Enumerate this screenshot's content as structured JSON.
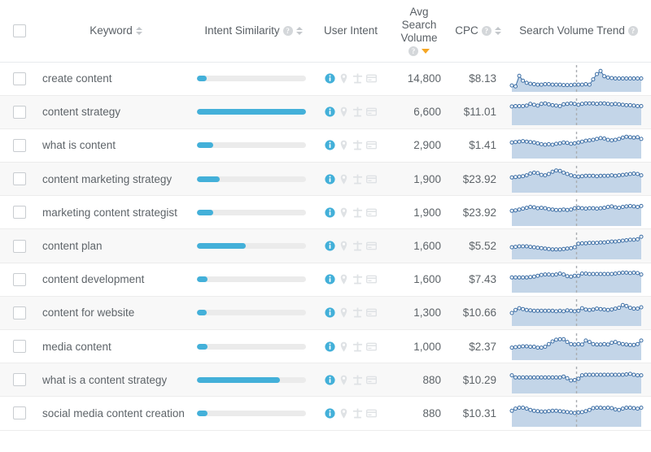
{
  "table": {
    "columns": {
      "select_all": "",
      "keyword": "Keyword",
      "intent_similarity": "Intent Similarity",
      "user_intent": "User Intent",
      "avg_search_volume_line1": "Avg",
      "avg_search_volume_line2": "Search",
      "avg_search_volume_line3": "Volume",
      "cpc": "CPC",
      "search_volume_trend": "Search Volume Trend"
    },
    "icons": {
      "help": "?",
      "sort": "sort-updown-icon",
      "sort_active_desc": "sort-desc-active-icon",
      "intent_informational": "info-icon",
      "intent_navigational": "map-pin-icon",
      "intent_commercial": "cart-icon",
      "intent_transactional": "credit-card-icon"
    },
    "colors": {
      "accent_blue": "#43b0d9",
      "bar_track": "#ebebeb",
      "sort_active_orange": "#f5a623",
      "spark_line": "#3c6ea5",
      "spark_fill": "#c3d5e8",
      "row_alt": "#f8f8f8"
    },
    "rows": [
      {
        "keyword": "create content",
        "intent_similarity_pct": 9,
        "intent_active": "informational",
        "avg_search_volume": "14,800",
        "cpc": "$8.13",
        "trend": [
          18,
          14,
          62,
          40,
          30,
          26,
          24,
          22,
          22,
          24,
          24,
          22,
          22,
          22,
          20,
          20,
          20,
          22,
          22,
          22,
          24,
          22,
          46,
          70,
          84,
          60,
          54,
          52,
          50,
          50,
          50,
          50,
          50,
          50,
          50,
          50
        ]
      },
      {
        "keyword": "content strategy",
        "intent_similarity_pct": 100,
        "intent_active": "informational",
        "avg_search_volume": "6,600",
        "cpc": "$11.01",
        "trend": [
          74,
          76,
          76,
          76,
          78,
          86,
          82,
          78,
          86,
          88,
          84,
          80,
          78,
          76,
          84,
          86,
          88,
          86,
          82,
          86,
          88,
          88,
          88,
          86,
          88,
          88,
          86,
          84,
          86,
          84,
          82,
          80,
          80,
          78,
          76,
          76
        ]
      },
      {
        "keyword": "what is content",
        "intent_similarity_pct": 15,
        "intent_active": "informational",
        "avg_search_volume": "2,900",
        "cpc": "$1.41",
        "trend": [
          62,
          64,
          66,
          68,
          66,
          64,
          62,
          58,
          54,
          52,
          54,
          52,
          56,
          58,
          62,
          60,
          56,
          58,
          62,
          66,
          70,
          72,
          74,
          78,
          82,
          80,
          74,
          72,
          74,
          78,
          84,
          88,
          86,
          84,
          86,
          78
        ]
      },
      {
        "keyword": "content marketing strategy",
        "intent_similarity_pct": 21,
        "intent_active": "informational",
        "avg_search_volume": "1,900",
        "cpc": "$23.92",
        "trend": [
          58,
          60,
          62,
          64,
          68,
          76,
          80,
          78,
          70,
          68,
          74,
          84,
          90,
          88,
          80,
          74,
          68,
          64,
          62,
          64,
          66,
          66,
          66,
          64,
          66,
          66,
          66,
          68,
          66,
          68,
          70,
          72,
          74,
          76,
          74,
          68
        ]
      },
      {
        "keyword": "marketing content strategist",
        "intent_similarity_pct": 15,
        "intent_active": "informational",
        "avg_search_volume": "1,900",
        "cpc": "$23.92",
        "trend": [
          58,
          60,
          64,
          68,
          72,
          76,
          74,
          70,
          72,
          70,
          66,
          64,
          62,
          62,
          64,
          62,
          64,
          70,
          72,
          70,
          68,
          70,
          70,
          68,
          70,
          72,
          76,
          78,
          74,
          72,
          76,
          78,
          80,
          78,
          76,
          80
        ]
      },
      {
        "keyword": "content plan",
        "intent_similarity_pct": 45,
        "intent_active": "informational",
        "avg_search_volume": "1,600",
        "cpc": "$5.52",
        "trend": [
          44,
          46,
          48,
          48,
          48,
          46,
          44,
          42,
          40,
          38,
          36,
          34,
          34,
          34,
          36,
          38,
          40,
          44,
          60,
          62,
          62,
          64,
          64,
          64,
          66,
          66,
          68,
          70,
          70,
          72,
          74,
          76,
          78,
          78,
          80,
          92
        ]
      },
      {
        "keyword": "content development",
        "intent_similarity_pct": 10,
        "intent_active": "informational",
        "avg_search_volume": "1,600",
        "cpc": "$7.43",
        "trend": [
          58,
          58,
          58,
          58,
          58,
          60,
          62,
          66,
          70,
          72,
          72,
          70,
          72,
          76,
          72,
          64,
          62,
          66,
          66,
          76,
          76,
          74,
          74,
          74,
          74,
          74,
          74,
          74,
          76,
          78,
          80,
          80,
          78,
          80,
          78,
          72
        ]
      },
      {
        "keyword": "content for website",
        "intent_similarity_pct": 9,
        "intent_active": "informational",
        "avg_search_volume": "1,300",
        "cpc": "$10.66",
        "trend": [
          48,
          62,
          70,
          66,
          62,
          60,
          58,
          58,
          58,
          58,
          58,
          58,
          56,
          58,
          56,
          60,
          58,
          56,
          58,
          70,
          64,
          62,
          64,
          68,
          66,
          64,
          62,
          64,
          68,
          72,
          84,
          80,
          72,
          68,
          68,
          74
        ]
      },
      {
        "keyword": "media content",
        "intent_similarity_pct": 10,
        "intent_active": "informational",
        "avg_search_volume": "1,000",
        "cpc": "$2.37",
        "trend": [
          46,
          48,
          50,
          52,
          52,
          50,
          50,
          46,
          46,
          50,
          62,
          74,
          82,
          84,
          84,
          72,
          62,
          60,
          62,
          60,
          78,
          72,
          62,
          60,
          60,
          62,
          60,
          68,
          72,
          66,
          62,
          60,
          58,
          58,
          62,
          78
        ]
      },
      {
        "keyword": "what is a content strategy",
        "intent_similarity_pct": 76,
        "intent_active": "informational",
        "avg_search_volume": "880",
        "cpc": "$10.29",
        "trend": [
          72,
          62,
          62,
          62,
          62,
          62,
          62,
          62,
          62,
          62,
          62,
          62,
          62,
          62,
          66,
          58,
          48,
          50,
          56,
          72,
          74,
          74,
          74,
          74,
          74,
          74,
          74,
          74,
          74,
          74,
          74,
          76,
          78,
          74,
          72,
          72
        ]
      },
      {
        "keyword": "social media content creation",
        "intent_similarity_pct": 10,
        "intent_active": "informational",
        "avg_search_volume": "880",
        "cpc": "$10.31",
        "trend": [
          62,
          72,
          76,
          76,
          72,
          66,
          62,
          60,
          58,
          58,
          60,
          62,
          62,
          60,
          58,
          56,
          54,
          52,
          54,
          56,
          60,
          66,
          74,
          76,
          76,
          74,
          76,
          74,
          68,
          66,
          72,
          76,
          76,
          74,
          72,
          76
        ]
      }
    ]
  }
}
